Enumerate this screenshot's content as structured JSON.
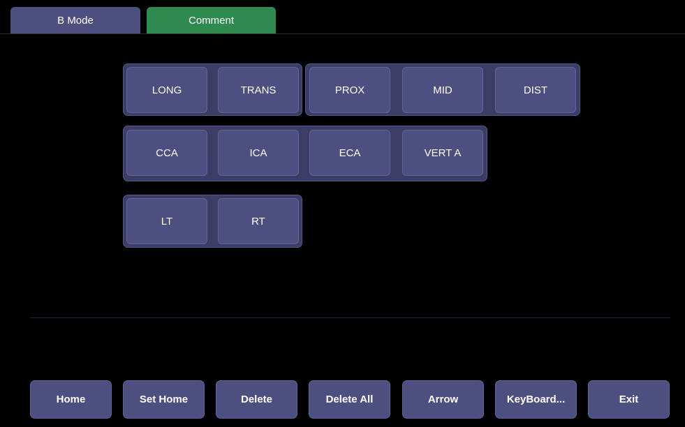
{
  "tabs": {
    "bmode": "B Mode",
    "comment": "Comment"
  },
  "comment_buttons": {
    "orientation": [
      "LONG",
      "TRANS"
    ],
    "position": [
      "PROX",
      "MID",
      "DIST"
    ],
    "vessel": [
      "CCA",
      "ICA",
      "ECA",
      "VERT A"
    ],
    "side": [
      "LT",
      "RT"
    ]
  },
  "toolbar": {
    "home": "Home",
    "set_home": "Set Home",
    "delete": "Delete",
    "delete_all": "Delete All",
    "arrow": "Arrow",
    "keyboard": "KeyBoard...",
    "exit": "Exit"
  },
  "colors": {
    "active_tab": "#2f8a4f",
    "inactive_tab": "#4c4f80",
    "button": "#4c4f80",
    "group_panel": "#3b3d66",
    "background": "#000000"
  }
}
